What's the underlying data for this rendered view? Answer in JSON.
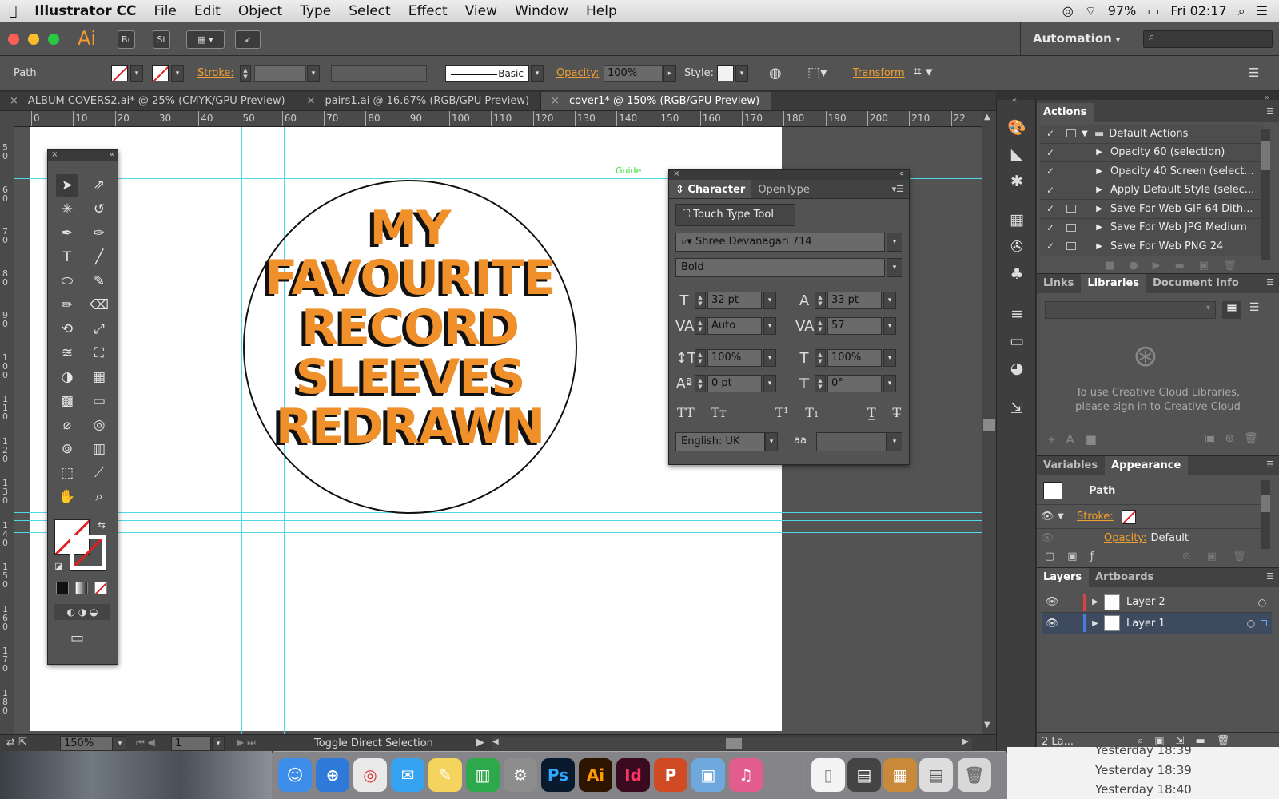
{
  "menubar": {
    "app": "Illustrator CC",
    "items": [
      "File",
      "Edit",
      "Object",
      "Type",
      "Select",
      "Effect",
      "View",
      "Window",
      "Help"
    ],
    "battery": "97%",
    "clock": "Fri 02:17"
  },
  "appbar": {
    "logo": "Ai",
    "bridge": "Br",
    "stock": "St",
    "workspace": "Automation"
  },
  "control": {
    "selection": "Path",
    "stroke_label": "Stroke:",
    "brush": "Basic",
    "opacity_label": "Opacity:",
    "opacity_value": "100%",
    "style_label": "Style:",
    "transform_label": "Transform"
  },
  "tabs": [
    {
      "label": "ALBUM COVERS2.ai* @ 25% (CMYK/GPU Preview)"
    },
    {
      "label": "pairs1.ai @ 16.67% (RGB/GPU Preview)"
    },
    {
      "label": "cover1* @ 150% (RGB/GPU Preview)"
    }
  ],
  "ruler_top": [
    "0",
    "10",
    "20",
    "30",
    "40",
    "50",
    "60",
    "70",
    "80",
    "90",
    "100",
    "110",
    "120",
    "130",
    "140",
    "150",
    "160",
    "170",
    "180",
    "190",
    "200",
    "210",
    "22"
  ],
  "ruler_left": [
    "5 0",
    "6 0",
    "7 0",
    "8 0",
    "9 0",
    "1 0 0",
    "1 1 0",
    "1 2 0",
    "1 3 0",
    "1 4 0",
    "1 5 0",
    "1 6 0",
    "1 7 0",
    "1 8 0"
  ],
  "artwork": {
    "lines": [
      "MY",
      "FAVOURITE",
      "RECORD",
      "SLEEVES",
      "REDRAWN"
    ],
    "guide_label": "Guide",
    "text_color": "#f0902a"
  },
  "character": {
    "tabs": [
      "Character",
      "OpenType"
    ],
    "touch_type": "Touch Type Tool",
    "font_family": "Shree Devanagari 714",
    "font_style": "Bold",
    "font_size": "32 pt",
    "leading": "33 pt",
    "kerning": "Auto",
    "tracking": "57",
    "vscale": "100%",
    "hscale": "100%",
    "baseline": "0 pt",
    "rotation": "0°",
    "language": "English: UK"
  },
  "status": {
    "zoom": "150%",
    "artboard": "1",
    "tool_hint": "Toggle Direct Selection"
  },
  "actions": {
    "title": "Actions",
    "rows": [
      {
        "label": "Default Actions",
        "folder": true
      },
      {
        "label": "Opacity 60 (selection)"
      },
      {
        "label": "Opacity 40 Screen (select..."
      },
      {
        "label": "Apply Default Style (selec..."
      },
      {
        "label": "Save For Web GIF 64 Dith..."
      },
      {
        "label": "Save For Web JPG Medium"
      },
      {
        "label": "Save For Web PNG 24"
      }
    ]
  },
  "libraries": {
    "tabs": [
      "Links",
      "Libraries",
      "Document Info"
    ],
    "message_line1": "To use Creative Cloud Libraries,",
    "message_line2": "please sign in to Creative Cloud"
  },
  "appearance": {
    "tabs": [
      "Variables",
      "Appearance"
    ],
    "object": "Path",
    "stroke_label": "Stroke:",
    "opacity_label": "Opacity:",
    "opacity_value": "Default"
  },
  "layers": {
    "tabs": [
      "Layers",
      "Artboards"
    ],
    "items": [
      {
        "name": "Layer 2",
        "color": "#e04040"
      },
      {
        "name": "Layer 1",
        "color": "#4a7ae0"
      }
    ],
    "count": "2 La..."
  },
  "finder": {
    "rows": [
      "Yesterday 18:39",
      "Yesterday 18:39",
      "Yesterday 18:40"
    ]
  },
  "dock": {
    "apps": [
      {
        "name": "Finder",
        "color": "#3d8ee8",
        "glyph": "☺"
      },
      {
        "name": "Safari",
        "color": "#2f7ad8",
        "glyph": "⊕"
      },
      {
        "name": "Chrome",
        "color": "#e9e9e9",
        "glyph": "◎"
      },
      {
        "name": "Messages",
        "color": "#35a3f0",
        "glyph": "✉"
      },
      {
        "name": "Notes",
        "color": "#f4d35e",
        "glyph": "✎"
      },
      {
        "name": "Numbers",
        "color": "#2da84a",
        "glyph": "▥"
      },
      {
        "name": "System Preferences",
        "color": "#8d8d8d",
        "glyph": "⚙"
      },
      {
        "name": "Photoshop",
        "color": "#0a1a2e",
        "glyph": "Ps"
      },
      {
        "name": "Illustrator",
        "color": "#2c1400",
        "glyph": "Ai"
      },
      {
        "name": "InDesign",
        "color": "#3a0a1e",
        "glyph": "Id"
      },
      {
        "name": "PowerPoint",
        "color": "#d04b24",
        "glyph": "P"
      },
      {
        "name": "Preview",
        "color": "#6fa8dc",
        "glyph": "▣"
      },
      {
        "name": "iTunes",
        "color": "#e25c8c",
        "glyph": "♫"
      }
    ]
  }
}
